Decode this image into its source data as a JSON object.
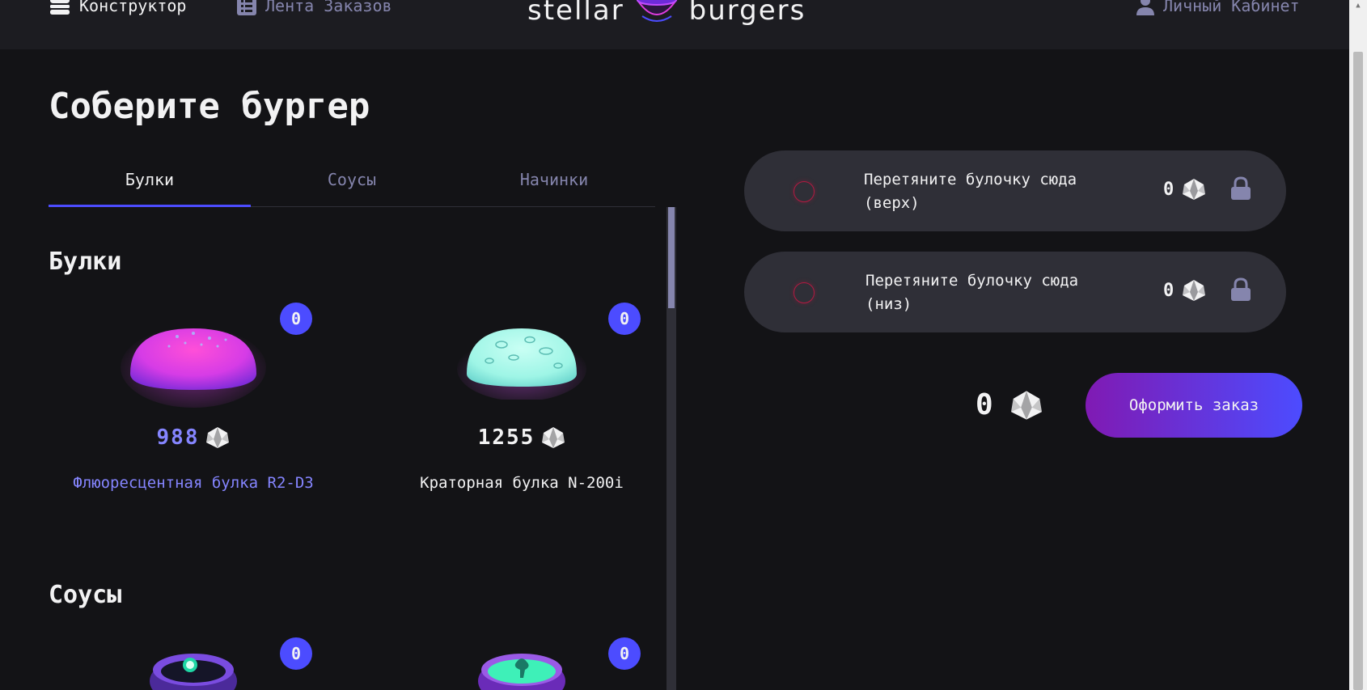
{
  "header": {
    "nav": {
      "constructor_label": "Конструктор",
      "feed_label": "Лента Заказов",
      "profile_label": "Личный Кабинет"
    },
    "logo": {
      "left_text": "stellar",
      "right_text": "burgers"
    }
  },
  "main": {
    "title": "Соберите бургер",
    "tabs": [
      {
        "label": "Булки",
        "active": true
      },
      {
        "label": "Соусы",
        "active": false
      },
      {
        "label": "Начинки",
        "active": false
      }
    ],
    "sections": {
      "buns": {
        "title": "Булки",
        "items": [
          {
            "name": "Флюоресцентная булка R2-D3",
            "price": "988",
            "count": "0"
          },
          {
            "name": "Краторная булка N-200i",
            "price": "1255",
            "count": "0"
          }
        ]
      },
      "sauces": {
        "title": "Соусы",
        "items": [
          {
            "count": "0"
          },
          {
            "count": "0"
          }
        ]
      }
    }
  },
  "constructor": {
    "top_bun": {
      "text": "Перетяните булочку сюда (верх)",
      "price": "0"
    },
    "bottom_bun": {
      "text": "Перетяните булочку сюда (низ)",
      "price": "0"
    },
    "total": "0",
    "order_button": "Оформить заказ"
  },
  "colors": {
    "background": "#131316",
    "header": "#1c1c21",
    "accent": "#4c4cff",
    "highlight_text": "#8585ff",
    "slot": "#2f2f37",
    "drag_circle": "#b21a41",
    "button_gradient_start": "#801ab3",
    "button_gradient_end": "#4c4cff"
  },
  "icons": [
    "burger-icon",
    "list-icon",
    "profile-icon",
    "currency-icon",
    "lock-icon"
  ]
}
